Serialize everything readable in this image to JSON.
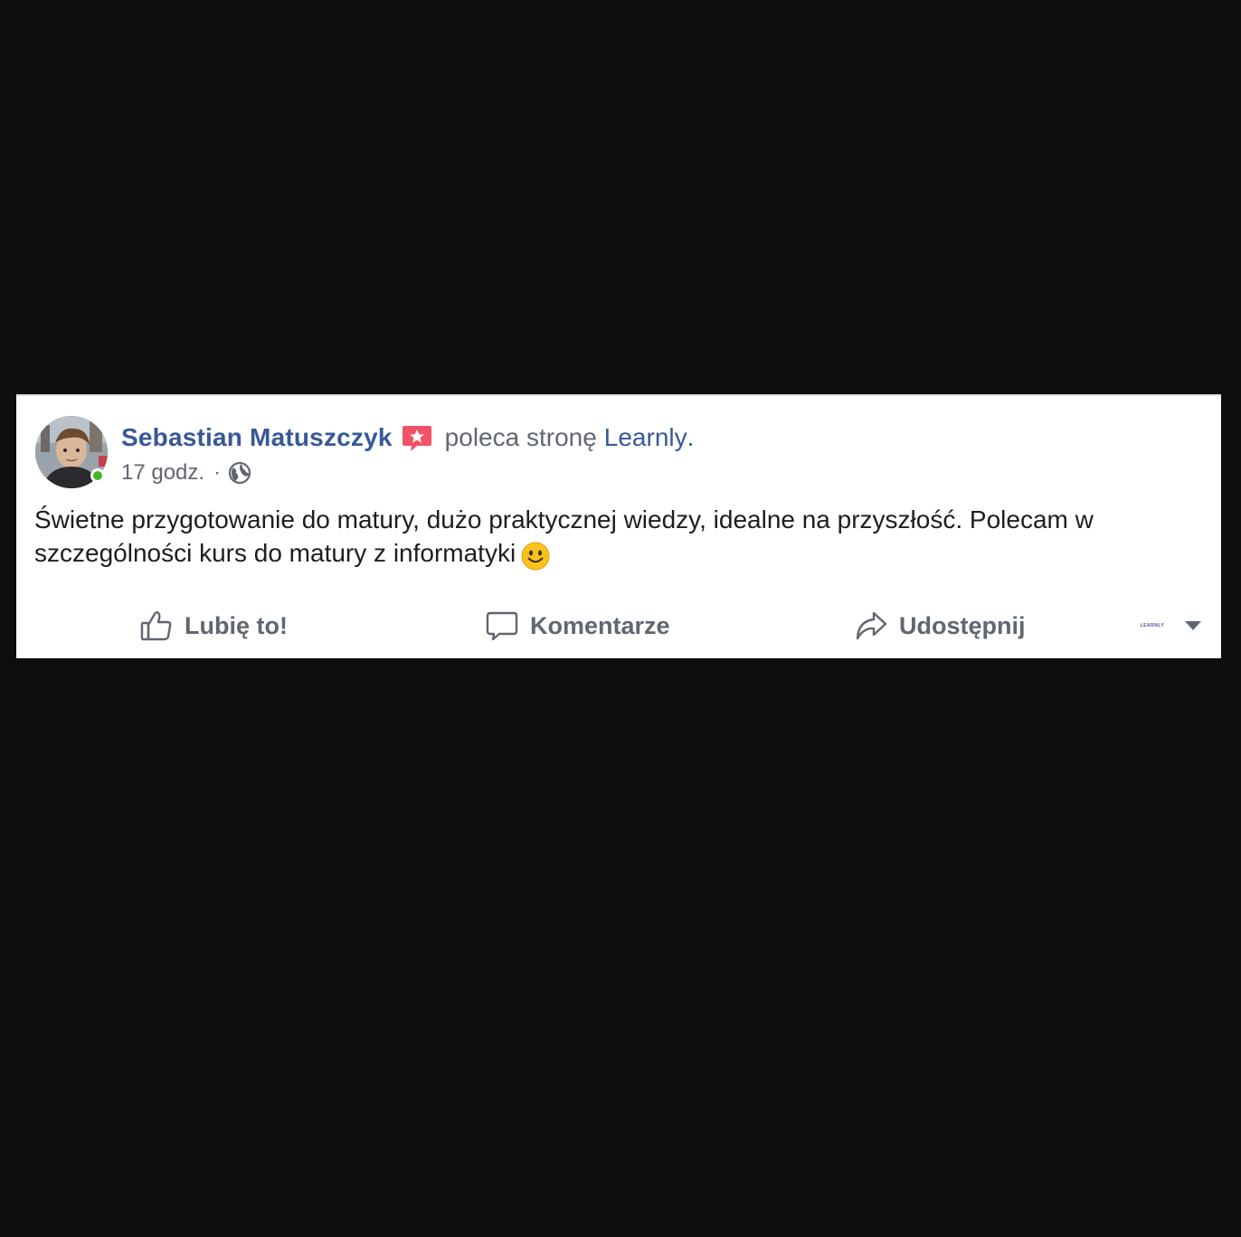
{
  "post": {
    "author_name": "Sebastian Matuszczyk",
    "recommends_text": "poleca stronę",
    "page_name": "Learnly",
    "page_name_suffix": ".",
    "timestamp": "17 godz.",
    "meta_separator": "·",
    "privacy_icon": "globe-icon",
    "badge_icon": "recommend-star-icon",
    "online_status": "online",
    "body_text": "Świetne przygotowanie do matury, dużo praktycznej wiedzy, idealne na przyszłość. Polecam w szczególności kurs do matury z informatyki",
    "body_emoji_icon": "smiley-face-icon"
  },
  "actions": {
    "like_label": "Lubię to!",
    "comment_label": "Komentarze",
    "share_label": "Udostępnij",
    "page_selector_logo": "LEARNLY"
  },
  "colors": {
    "link_blue": "#385898",
    "secondary_gray": "#606770",
    "online_green": "#42b72a",
    "badge_red": "#f25268",
    "background": "#0e0e0f"
  }
}
